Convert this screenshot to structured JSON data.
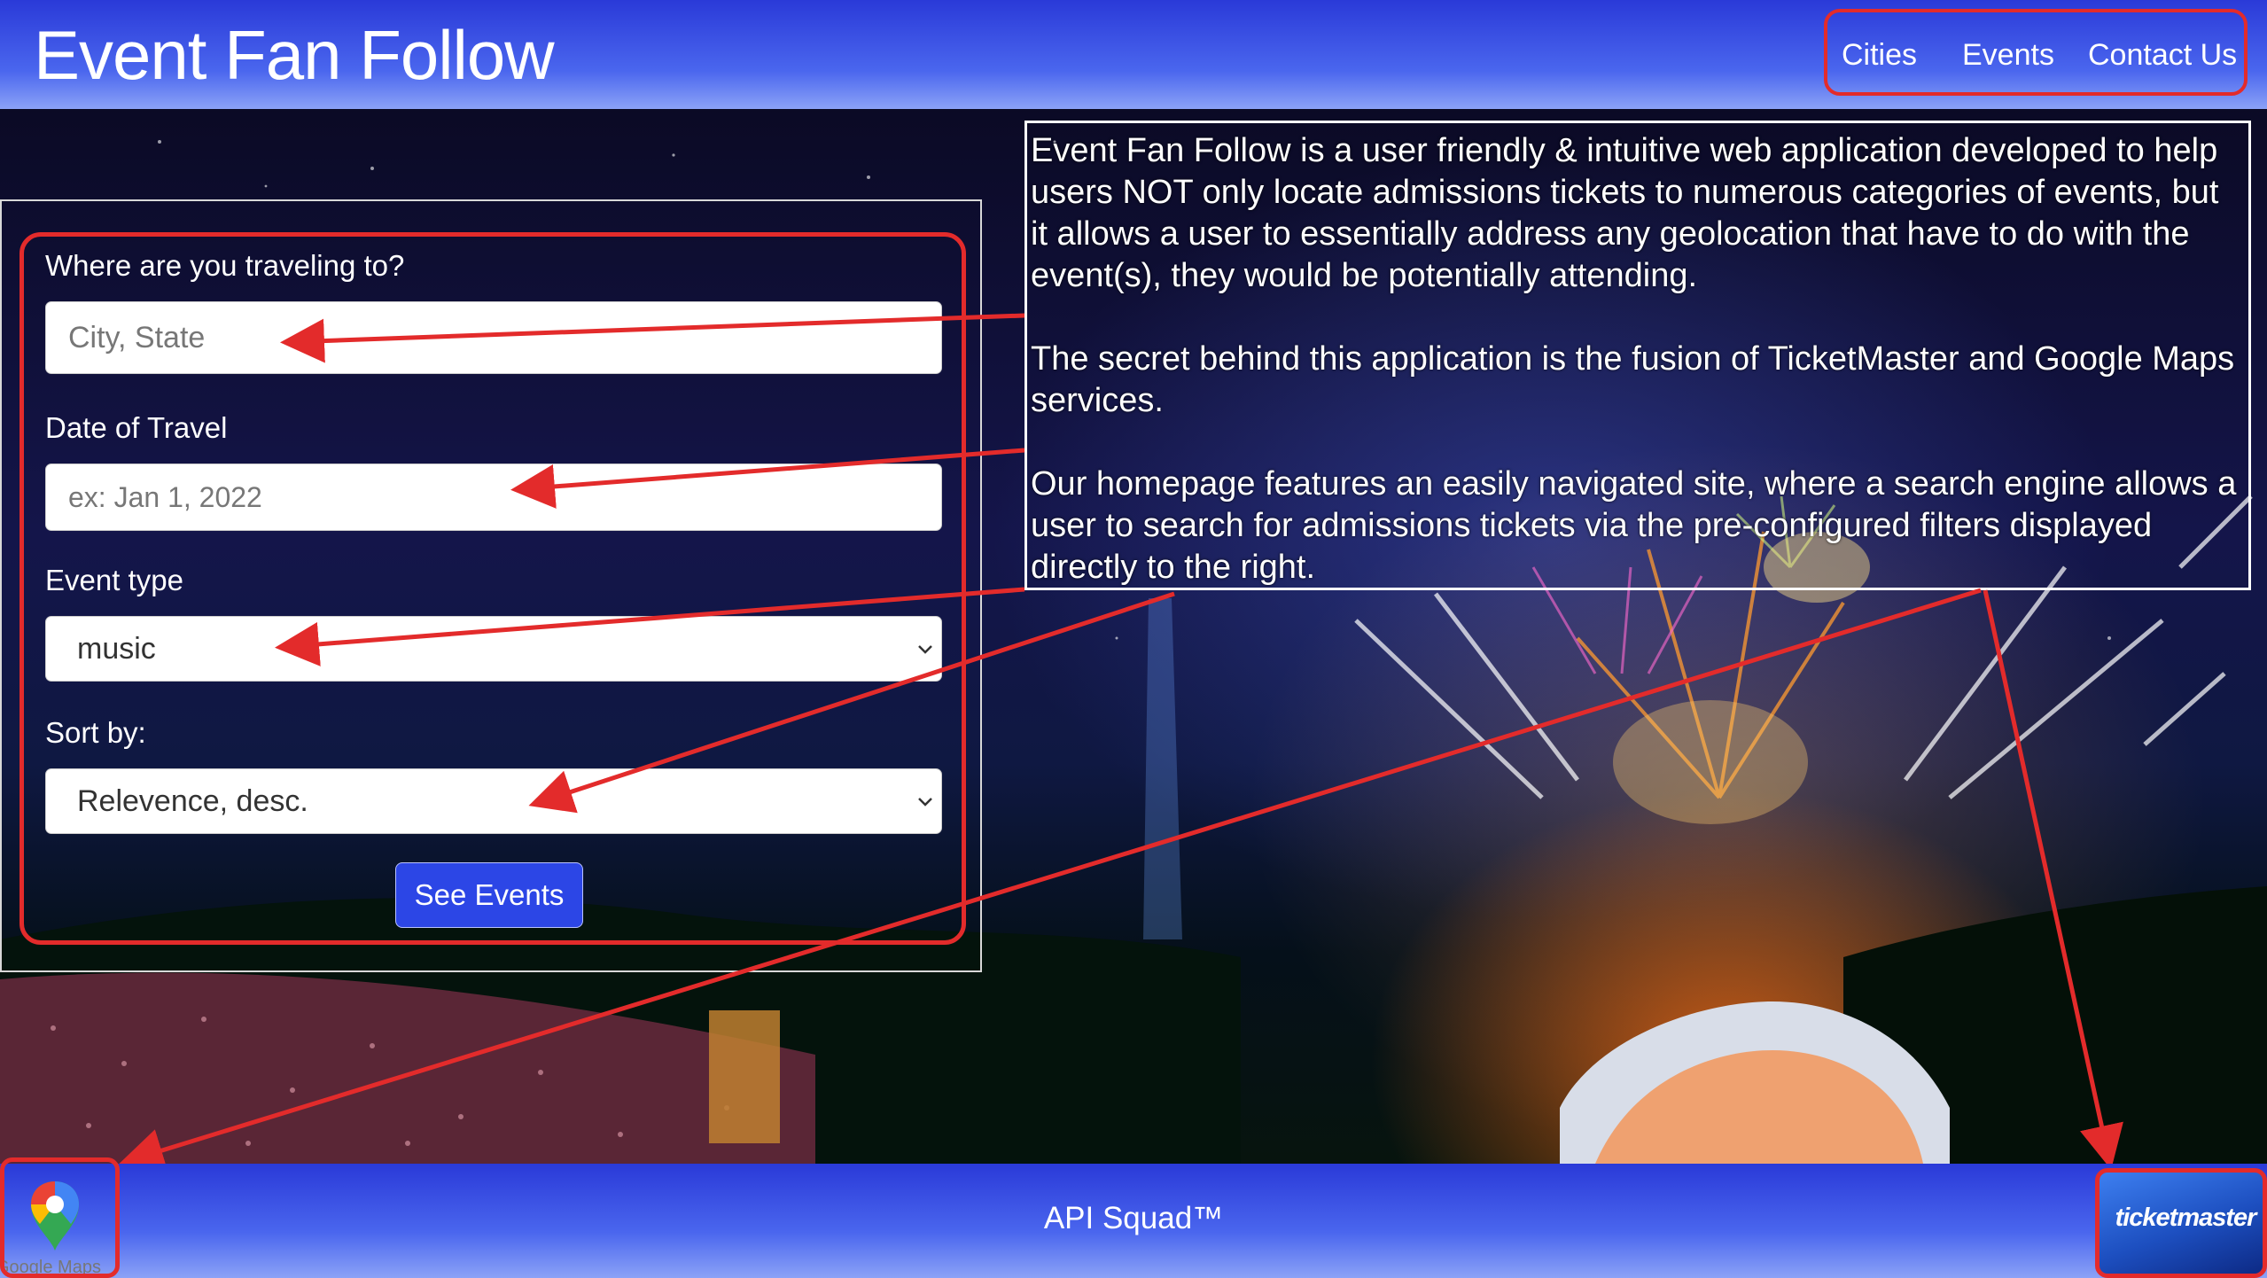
{
  "header": {
    "title": "Event Fan Follow",
    "nav": [
      {
        "label": "Cities"
      },
      {
        "label": "Events"
      },
      {
        "label": "Contact Us"
      }
    ]
  },
  "search_form": {
    "destination": {
      "label": "Where are you traveling to?",
      "placeholder": "City, State",
      "value": ""
    },
    "date": {
      "label": "Date of Travel",
      "placeholder": "ex: Jan 1, 2022",
      "value": ""
    },
    "event_type": {
      "label": "Event type",
      "selected": "music"
    },
    "sort_by": {
      "label": "Sort by:",
      "selected": "Relevence, desc."
    },
    "submit_label": "See Events"
  },
  "description": {
    "paragraphs": [
      "Event Fan Follow is a user friendly & intuitive web application developed to help users NOT only locate admissions tickets to numerous categories of events, but it allows a user to essentially address any geolocation that have to do with the event(s), they would be potentially attending.",
      "The secret behind this application is the fusion of TicketMaster and Google Maps services.",
      "Our homepage features an easily navigated site, where a search engine allows a user to search for admissions tickets via the pre-configured filters displayed directly to the right."
    ]
  },
  "footer": {
    "text": "API Squad™",
    "google_maps_label": "Google Maps",
    "ticketmaster_label": "ticketmaster"
  },
  "colors": {
    "header_blue": "#2a3ad8",
    "annotation_red": "#e32b2b",
    "button_blue": "#2c46e6"
  },
  "icons": [
    "google-maps-pin-icon",
    "chevron-down-icon",
    "ticketmaster-logo"
  ]
}
